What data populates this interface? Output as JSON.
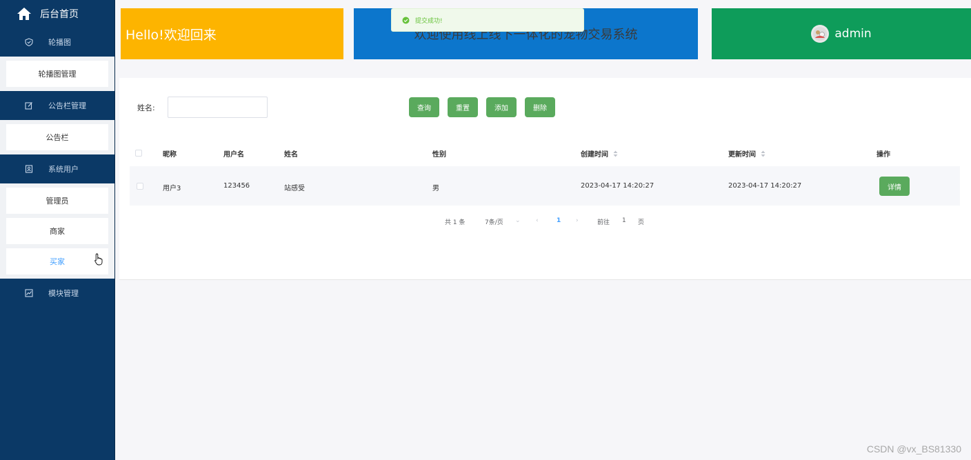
{
  "sidebar": {
    "home_label": "后台首页",
    "groups": [
      {
        "label": "轮播图",
        "icon": "shield-icon",
        "items": [
          "轮播图管理"
        ]
      },
      {
        "label": "公告栏管理",
        "icon": "edit-icon",
        "items": [
          "公告栏"
        ]
      },
      {
        "label": "系统用户",
        "icon": "user-card-icon",
        "items": [
          "管理员",
          "商家",
          "买家"
        ]
      },
      {
        "label": "模块管理",
        "icon": "chart-icon",
        "items": []
      }
    ]
  },
  "header": {
    "welcome": "Hello!欢迎回来",
    "system_title": "欢迎使用线上线下一体化的宠物交易系统",
    "username": "admin"
  },
  "toast": {
    "message": "提交成功!"
  },
  "search": {
    "label": "姓名:",
    "value": "",
    "placeholder": ""
  },
  "buttons": {
    "query": "查询",
    "reset": "重置",
    "add": "添加",
    "delete": "删除"
  },
  "table": {
    "columns": [
      "昵称",
      "用户名",
      "姓名",
      "性别",
      "创建时间",
      "更新时间",
      "操作"
    ],
    "rows": [
      {
        "nickname": "用户3",
        "username": "123456",
        "name": "站感受",
        "gender": "男",
        "created": "2023-04-17 14:20:27",
        "updated": "2023-04-17 14:20:27",
        "action": "详情"
      }
    ]
  },
  "pagination": {
    "total": "共 1 条",
    "page_size": "7条/页",
    "current": "1",
    "goto_label": "前往",
    "goto_value": "1",
    "page_suffix": "页"
  },
  "watermark": "CSDN @vx_BS81330",
  "colors": {
    "sidebar": "#0b3966",
    "welcome": "#fdb400",
    "system": "#0c76cc",
    "user": "#0e9c5a",
    "button": "#5aaa5d",
    "active_link": "#409eff"
  }
}
